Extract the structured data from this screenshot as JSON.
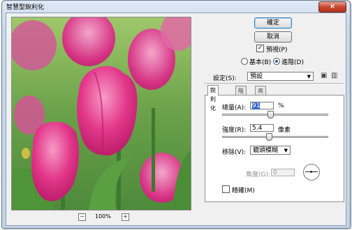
{
  "window": {
    "title": "智慧型銳利化",
    "close_label": "×"
  },
  "buttons": {
    "ok": "確定",
    "cancel": "取消"
  },
  "preview": {
    "checked": true,
    "label": "預視(P)"
  },
  "modes": {
    "basic": "基本(B)",
    "advanced": "進階(D)",
    "selected": "advanced"
  },
  "settings": {
    "label": "設定(S):",
    "value": "預設"
  },
  "tabs": [
    "銳利化",
    "陰影",
    "亮部"
  ],
  "fields": {
    "amount_label": "總量(A):",
    "amount_value": "91",
    "amount_unit": "%",
    "amount_slider": 0.455,
    "radius_label": "強度(R):",
    "radius_value": "5.4",
    "radius_unit": "像素",
    "radius_slider": 0.44,
    "remove_label": "移除(V):",
    "remove_value": "鏡頭模糊",
    "angle_label": "角度(G):",
    "angle_value": "0",
    "more_accurate_label": "精確(M)",
    "more_accurate_checked": false
  },
  "zoom": {
    "level": "100%",
    "minus": "−",
    "plus": "+"
  },
  "icons": {
    "save_settings": "floppy-icon",
    "delete_settings": "trash-icon"
  }
}
